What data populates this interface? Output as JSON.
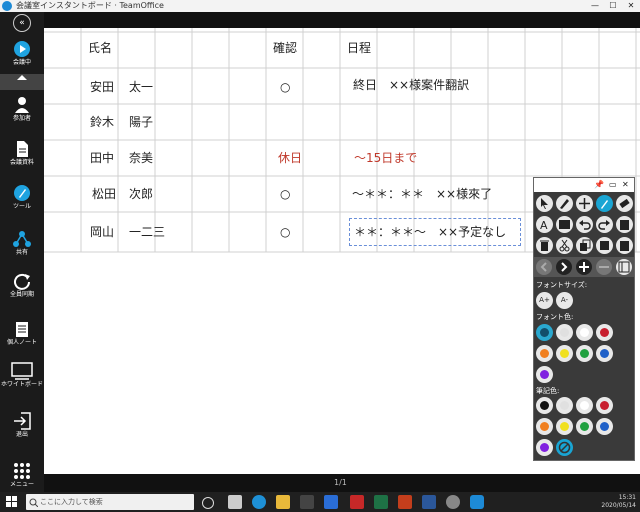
{
  "window": {
    "title": "会議室インスタントボード · TeamOffice",
    "minimize": "—",
    "maximize": "☐",
    "close": "✕"
  },
  "sidebar": {
    "collapse_icon": "double-chevron-left",
    "items": [
      {
        "label": "会議中",
        "icon": "play-circle"
      },
      {
        "label": "参加者",
        "icon": "person"
      },
      {
        "label": "会議資料",
        "icon": "document"
      },
      {
        "label": "ツール",
        "icon": "pen"
      },
      {
        "label": "共有",
        "icon": "share"
      },
      {
        "label": "全員同期",
        "icon": "refresh"
      },
      {
        "label": "個人ノート",
        "icon": "notebook"
      },
      {
        "label": "ホワイトボード",
        "icon": "monitor"
      },
      {
        "label": "退出",
        "icon": "exit"
      },
      {
        "label": "メニュー",
        "icon": "dots-grid"
      }
    ]
  },
  "sheet": {
    "headers": {
      "name": "氏名",
      "confirm": "確認",
      "schedule": "日程"
    },
    "rows": [
      {
        "last": "安田",
        "first": "太一",
        "confirm": "○",
        "schedule": "終日　××様案件翻訳"
      },
      {
        "last": "鈴木",
        "first": "陽子",
        "confirm": "",
        "schedule": ""
      },
      {
        "last": "田中",
        "first": "奈美",
        "confirm": "休日",
        "schedule": "～15日まで"
      },
      {
        "last": "松田",
        "first": "次郎",
        "confirm": "○",
        "schedule": "～＊＊：＊＊　××様來了"
      },
      {
        "last": "岡山",
        "first": "一二三",
        "confirm": "○",
        "schedule": "＊＊：＊＊～　××予定なし"
      }
    ]
  },
  "footer": {
    "page": "1/1"
  },
  "palette": {
    "pin": "📌",
    "minimize": "▭",
    "close": "✕",
    "font_size_label": "フォントサイズ:",
    "font_size_up": "A+",
    "font_size_down": "A-",
    "font_color_label": "フォント色:",
    "pen_color_label": "筆記色:",
    "font_colors": [
      "#1f9cc4",
      "#e0e0e0",
      "#ffffff",
      "#c81e2e",
      "#f08020",
      "#f0e020",
      "#20a040",
      "#1f60c8",
      "#8020e0"
    ],
    "pen_colors": [
      "#111111",
      "#e0e0e0",
      "#ffffff",
      "#c81e2e",
      "#f08020",
      "#f0e020",
      "#20a040",
      "#1f60c8",
      "#8020e0"
    ]
  },
  "taskbar": {
    "search_placeholder": "ここに入力して検索",
    "time": "15:31",
    "date": "2020/05/14"
  }
}
